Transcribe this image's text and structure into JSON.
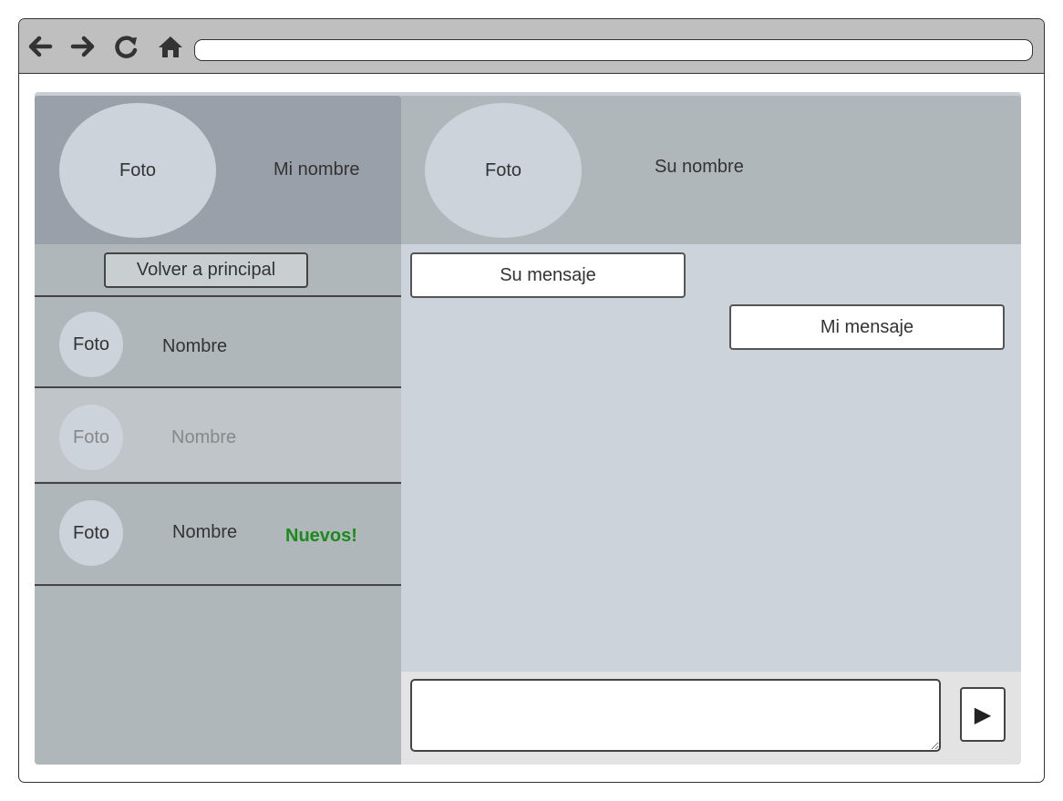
{
  "browser": {
    "icons": [
      "back-arrow-icon",
      "forward-arrow-icon",
      "reload-icon",
      "home-icon"
    ],
    "url": ""
  },
  "profile": {
    "photo_label": "Foto",
    "name": "Mi nombre"
  },
  "chat_partner": {
    "photo_label": "Foto",
    "name": "Su nombre"
  },
  "sidebar": {
    "back_button": "Volver a principal",
    "contacts": [
      {
        "photo_label": "Foto",
        "name": "Nombre",
        "badge": ""
      },
      {
        "photo_label": "Foto",
        "name": "Nombre",
        "badge": ""
      },
      {
        "photo_label": "Foto",
        "name": "Nombre",
        "badge": "Nuevos!"
      }
    ]
  },
  "messages": [
    {
      "from": "them",
      "text": "Su mensaje"
    },
    {
      "from": "me",
      "text": "Mi mensaje"
    }
  ],
  "composer": {
    "input_value": "",
    "send_glyph": "▶"
  },
  "colors": {
    "badge_new": "#1b8a1b"
  }
}
